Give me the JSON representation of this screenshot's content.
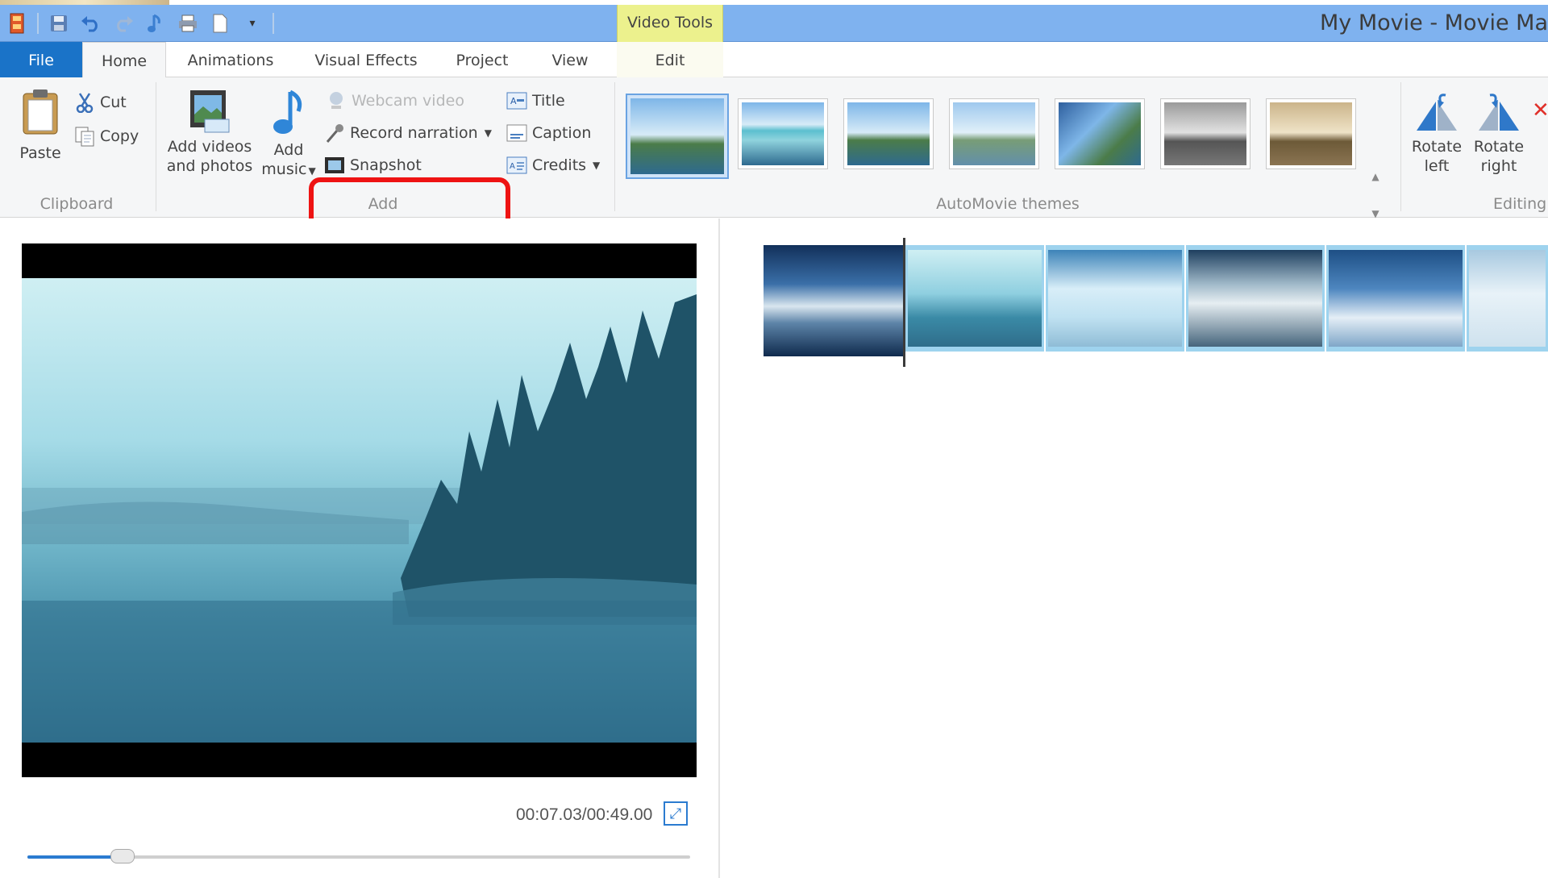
{
  "window": {
    "title": "My Movie - Movie Ma"
  },
  "contextual_tab": {
    "label": "Video Tools"
  },
  "quick_access": [
    "app-menu-icon",
    "save-icon",
    "undo-icon",
    "redo-icon",
    "music-note-icon",
    "print-icon",
    "new-document-icon",
    "customize-dropdown-icon"
  ],
  "tabs": {
    "file": "File",
    "home": "Home",
    "animations": "Animations",
    "visual_effects": "Visual Effects",
    "project": "Project",
    "view": "View",
    "edit": "Edit"
  },
  "ribbon": {
    "clipboard": {
      "group_label": "Clipboard",
      "paste": "Paste",
      "cut": "Cut",
      "copy": "Copy"
    },
    "add": {
      "group_label": "Add",
      "add_videos_line1": "Add videos",
      "add_videos_line2": "and photos",
      "add_music_line1": "Add",
      "add_music_line2": "music",
      "webcam_video": "Webcam video",
      "record_narration": "Record narration",
      "snapshot": "Snapshot",
      "title": "Title",
      "caption": "Caption",
      "credits": "Credits"
    },
    "themes": {
      "group_label": "AutoMovie themes",
      "items": [
        "default-theme",
        "contemporary-theme",
        "cinematic-theme",
        "fade-theme",
        "pan-and-zoom-theme",
        "black-and-white-theme",
        "sepia-theme"
      ],
      "selected_index": 0
    },
    "editing": {
      "group_label": "Editing",
      "rotate_left_line1": "Rotate",
      "rotate_left_line2": "left",
      "rotate_right_line1": "Rotate",
      "rotate_right_line2": "right"
    }
  },
  "player": {
    "timecode": "00:07.03/00:49.00",
    "progress": 0.1435
  },
  "storyboard": {
    "clips": [
      "waterfall-clip",
      "misty-lake-clip",
      "frozen-shore-clip",
      "frosted-tree-clip",
      "falls-closeup-clip",
      "snow-plain-clip"
    ],
    "selected_index": 1
  },
  "colors": {
    "accent": "#1a73c8",
    "highlight": "#ee1313",
    "contextual": "#ecf18d"
  }
}
